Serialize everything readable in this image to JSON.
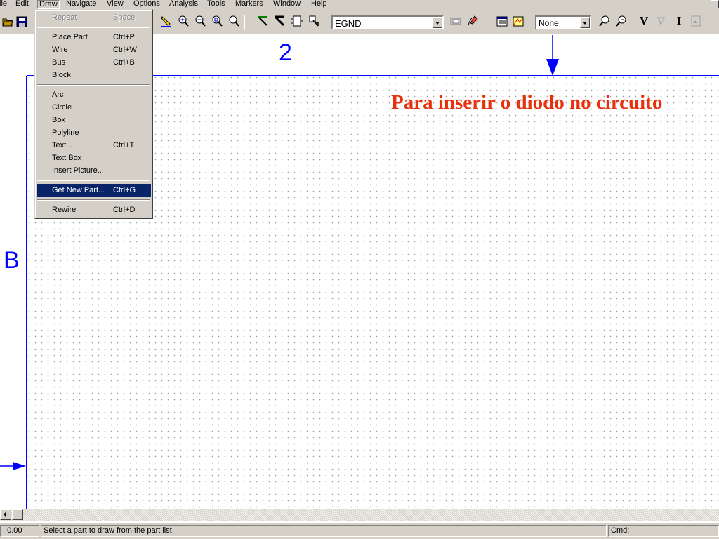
{
  "menubar": {
    "items": [
      "ile",
      "Edit",
      "Draw",
      "Navigate",
      "View",
      "Options",
      "Analysis",
      "Tools",
      "Markers",
      "Window",
      "Help"
    ]
  },
  "toolbar": {
    "part_combo_value": "EGND",
    "zoom_combo_value": "None",
    "icons": [
      "open-icon",
      "save-icon",
      "pencil-icon",
      "zoom-in-icon",
      "zoom-out-icon",
      "zoom-area-icon",
      "zoom-all-icon",
      "wire-icon",
      "bus-icon",
      "block-icon",
      "get-part-icon",
      "netlist-icon",
      "simulate-icon",
      "setup-icon",
      "probe-icon",
      "find-icon",
      "voltage-icon",
      "current-icon",
      "enable-icon"
    ],
    "voltage_label": "V",
    "current_label": "I"
  },
  "draw_menu": {
    "items": [
      {
        "label": "Repeat",
        "shortcut": "Space",
        "disabled": true
      },
      {
        "label": "Place Part",
        "shortcut": "Ctrl+P"
      },
      {
        "label": "Wire",
        "shortcut": "Ctrl+W"
      },
      {
        "label": "Bus",
        "shortcut": "Ctrl+B"
      },
      {
        "label": "Block",
        "shortcut": ""
      },
      {
        "label": "Arc",
        "shortcut": ""
      },
      {
        "label": "Circle",
        "shortcut": ""
      },
      {
        "label": "Box",
        "shortcut": ""
      },
      {
        "label": "Polyline",
        "shortcut": ""
      },
      {
        "label": "Text...",
        "shortcut": "Ctrl+T"
      },
      {
        "label": "Text Box",
        "shortcut": ""
      },
      {
        "label": "Insert Picture...",
        "shortcut": ""
      },
      {
        "label": "Get New Part...",
        "shortcut": "Ctrl+G",
        "selected": true
      },
      {
        "label": "Rewire",
        "shortcut": "Ctrl+D"
      }
    ]
  },
  "canvas": {
    "zone_column": "2",
    "zone_row": "B",
    "annotation": "Para inserir o diodo no circuito",
    "annotation_color": "#e8310c",
    "border_color": "#0000ff"
  },
  "statusbar": {
    "coords": ", 0.00",
    "message": "Select a part to draw from the part list",
    "cmd": "Cmd:"
  }
}
